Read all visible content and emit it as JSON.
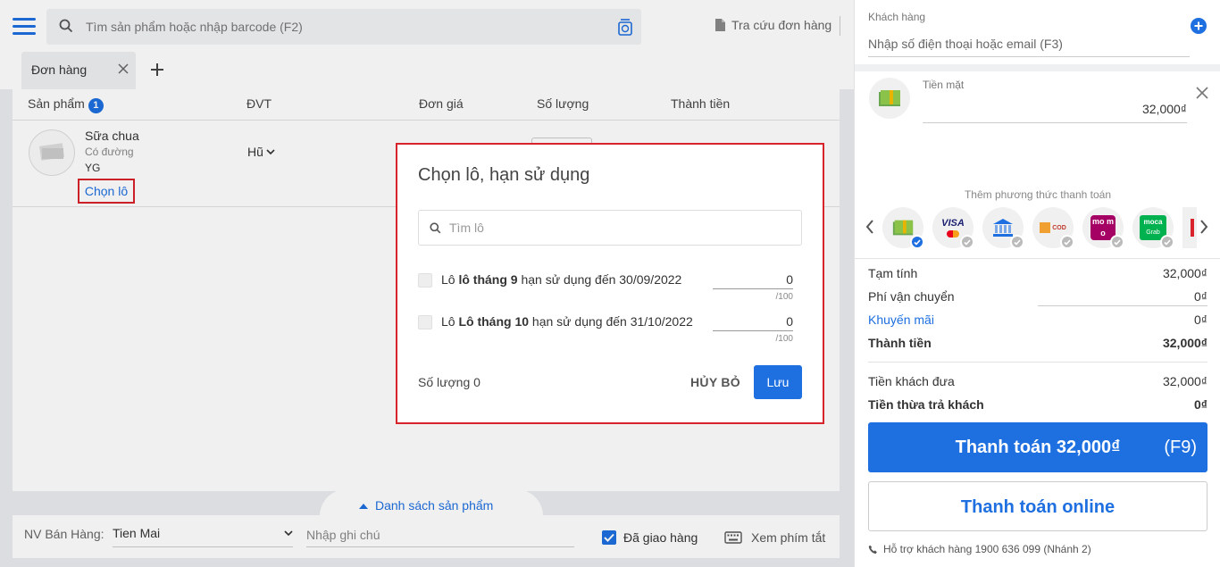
{
  "header": {
    "search_placeholder": "Tìm sản phẩm hoặc nhập barcode (F2)",
    "lookup_label": "Tra cứu đơn hàng"
  },
  "tabs": [
    {
      "label": "Đơn hàng"
    }
  ],
  "table": {
    "columns": {
      "product": "Sản phẩm",
      "product_count": "1",
      "unit": "ĐVT",
      "price": "Đơn giá",
      "quantity": "Số lượng",
      "total": "Thành tiền"
    },
    "rows": [
      {
        "name": "Sữa chua",
        "variant": "Có đường",
        "code": "YG",
        "pick_lot_label": "Chọn lô",
        "unit": "Hũ"
      }
    ]
  },
  "product_list_toggle": "Danh sách sản phẩm",
  "footer": {
    "staff_label": "NV Bán Hàng:",
    "staff_value": "Tien Mai",
    "note_placeholder": "Nhập ghi chú",
    "delivered_label": "Đã giao hàng",
    "delivered_checked": true,
    "shortcuts_label": "Xem phím tắt"
  },
  "modal": {
    "title": "Chọn lô, hạn sử dụng",
    "search_placeholder": "Tìm lô",
    "lots": [
      {
        "prefix": "Lô ",
        "name": "lô tháng 9",
        "suffix": " hạn sử dụng đến 30/09/2022",
        "qty": "0",
        "max": "/100"
      },
      {
        "prefix": "Lô ",
        "name": "Lô tháng 10",
        "suffix": " hạn sử dụng đến 31/10/2022",
        "qty": "0",
        "max": "/100"
      }
    ],
    "total_label": "Số lượng 0",
    "cancel_label": "HỦY BỎ",
    "save_label": "Lưu"
  },
  "right_panel": {
    "customer_label": "Khách hàng",
    "customer_placeholder": "Nhập số điện thoại hoặc email (F3)",
    "cash_label": "Tiền mặt",
    "cash_value": "32,000₫",
    "add_method_label": "Thêm phương thức thanh toán",
    "methods": [
      {
        "icon": "cash-icon",
        "selected": true
      },
      {
        "icon": "visa-icon",
        "selected": false
      },
      {
        "icon": "bank-icon",
        "selected": false
      },
      {
        "icon": "cod-icon",
        "selected": false
      },
      {
        "icon": "momo-icon",
        "selected": false
      },
      {
        "icon": "moca-grab-icon",
        "selected": false
      },
      {
        "icon": "vnpay-icon",
        "selected": false
      }
    ],
    "method_text": {
      "visa": "VISA",
      "cod": "COD",
      "momo": "mo mo",
      "moca": "moca",
      "grab": "Grab"
    },
    "summary": {
      "subtotal_label": "Tạm tính",
      "subtotal_value": "32,000₫",
      "shipping_label": "Phí vận chuyển",
      "shipping_value": "0₫",
      "promo_label": "Khuyến mãi",
      "promo_value": "0₫",
      "total_label": "Thành tiền",
      "total_value": "32,000₫",
      "paid_label": "Tiền khách đưa",
      "paid_value": "32,000₫",
      "change_label": "Tiền thừa trả khách",
      "change_value": "0₫"
    },
    "pay_label": "Thanh toán 32,000₫",
    "pay_key": "(F9)",
    "online_label": "Thanh toán online",
    "support_text": "Hỗ trợ khách hàng 1900 636 099 (Nhánh 2)"
  },
  "colors": {
    "primary": "#1e6fe0",
    "highlight": "#d8232a"
  }
}
